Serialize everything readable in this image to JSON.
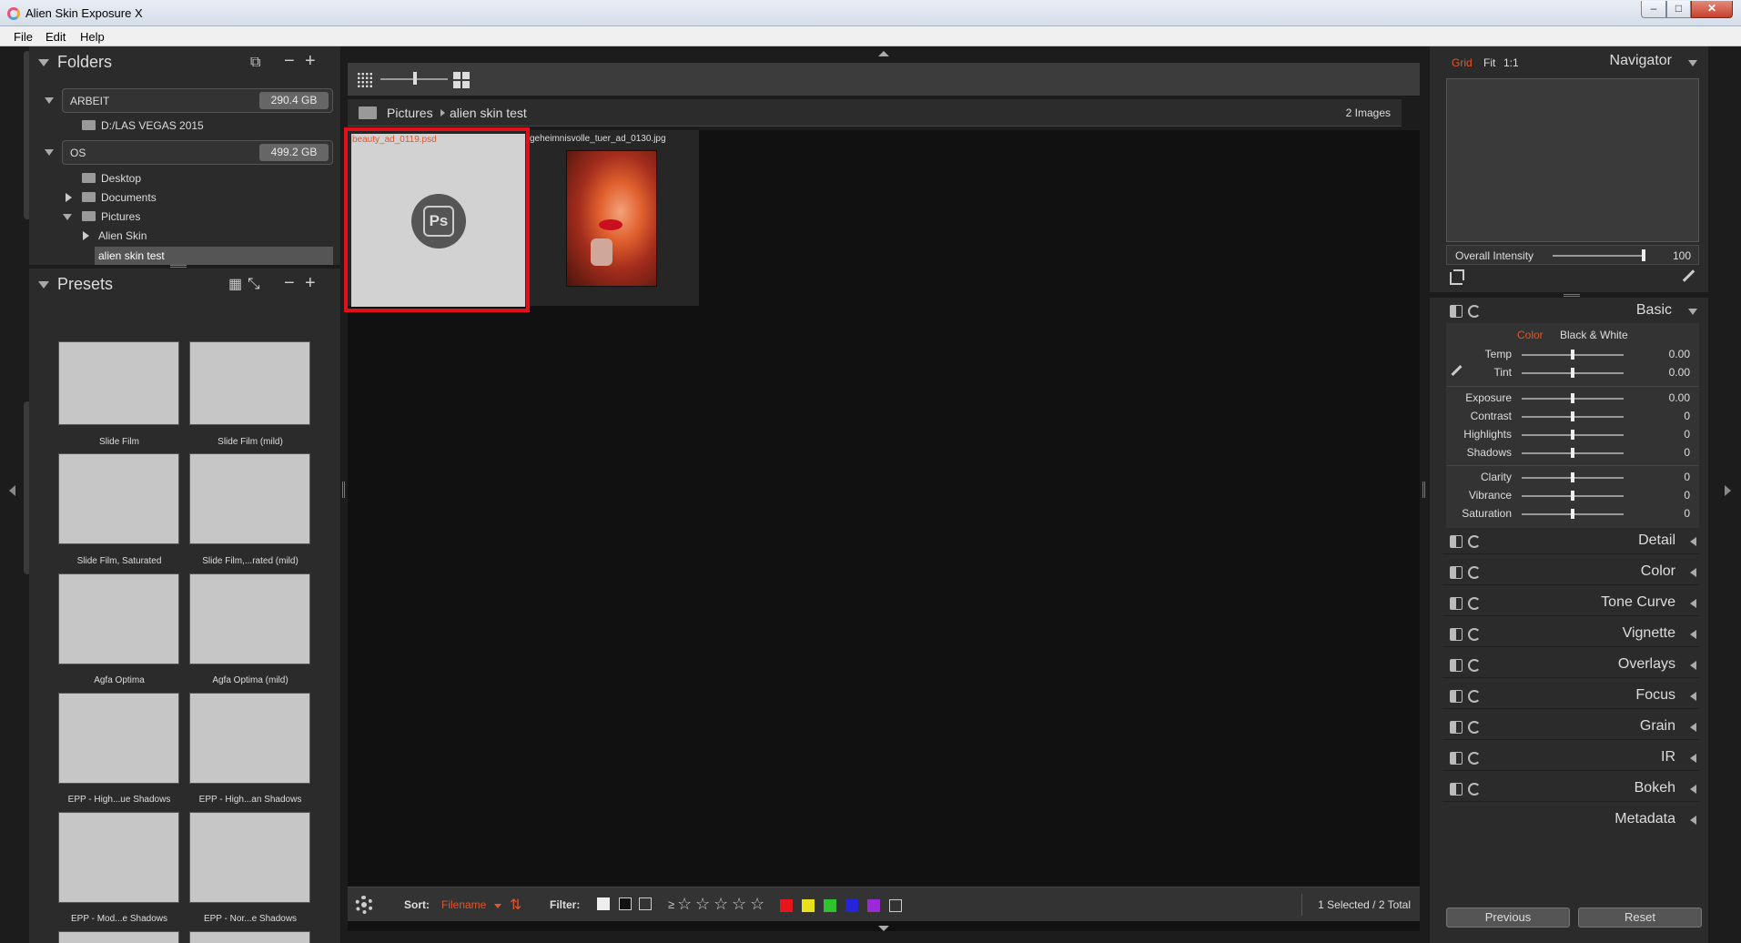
{
  "window": {
    "title": "Alien Skin Exposure X",
    "minimize": "–",
    "maximize": "□",
    "close": "✕"
  },
  "menu": [
    "File",
    "Edit",
    "Help"
  ],
  "folders": {
    "title": "Folders",
    "volumes": [
      {
        "name": "ARBEIT",
        "size": "290.4 GB"
      },
      {
        "name": "OS",
        "size": "499.2 GB"
      }
    ],
    "arbeit_child": "D:/LAS VEGAS 2015",
    "os_children": [
      "Desktop",
      "Documents",
      "Pictures"
    ],
    "pictures_children": [
      "Alien Skin",
      "alien skin test"
    ]
  },
  "presets": {
    "title": "Presets",
    "items": [
      "Slide Film",
      "Slide Film (mild)",
      "Slide Film, Saturated",
      "Slide Film,...rated (mild)",
      "Agfa Optima",
      "Agfa Optima (mild)",
      "EPP - High...ue Shadows",
      "EPP - High...an Shadows",
      "EPP - Mod...e Shadows",
      "EPP - Nor...e Shadows"
    ]
  },
  "breadcrumb": {
    "root": "Pictures",
    "current": "alien skin test",
    "count": "2 Images"
  },
  "images": [
    {
      "filename": "beauty_ad_0119.psd",
      "badge": "Ps"
    },
    {
      "filename": "geheimnisvolle_tuer_ad_0130.jpg"
    }
  ],
  "bottombar": {
    "sort_label": "Sort:",
    "sort_value": "Filename",
    "filter_label": "Filter:",
    "rating_prefix": "≥",
    "stars": [
      "☆",
      "☆",
      "☆",
      "☆",
      "☆"
    ],
    "color_labels": [
      "#e8141c",
      "#e8e01a",
      "#2ec42e",
      "#2424d8",
      "#9a2ad8"
    ],
    "status": "1 Selected / 2 Total"
  },
  "navigator": {
    "modes": [
      "Grid",
      "Fit",
      "1:1"
    ],
    "title": "Navigator",
    "intensity_label": "Overall Intensity",
    "intensity_value": "100",
    "intensity_fraction": 1.0
  },
  "basic": {
    "title": "Basic",
    "mode_color": "Color",
    "mode_bw": "Black & White",
    "sliders": [
      {
        "label": "Temp",
        "value": "0.00"
      },
      {
        "label": "Tint",
        "value": "0.00"
      },
      {
        "label": "Exposure",
        "value": "0.00"
      },
      {
        "label": "Contrast",
        "value": "0"
      },
      {
        "label": "Highlights",
        "value": "0"
      },
      {
        "label": "Shadows",
        "value": "0"
      },
      {
        "label": "Clarity",
        "value": "0"
      },
      {
        "label": "Vibrance",
        "value": "0"
      },
      {
        "label": "Saturation",
        "value": "0"
      }
    ]
  },
  "sections": [
    "Detail",
    "Color",
    "Tone Curve",
    "Vignette",
    "Overlays",
    "Focus",
    "Grain",
    "IR",
    "Bokeh"
  ],
  "metadata_title": "Metadata",
  "buttons": {
    "previous": "Previous",
    "reset": "Reset"
  },
  "accent_color": "#e0562d"
}
